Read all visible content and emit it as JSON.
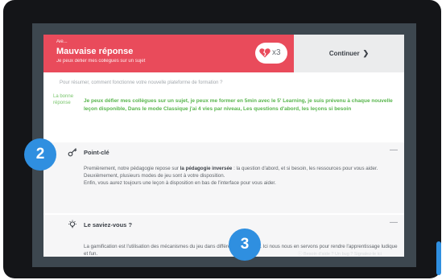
{
  "feedback": {
    "header_small": "Aie...",
    "title": "Mauvaise réponse",
    "subtitle": "Je peux défier mes collègues sur un sujet",
    "lives_count": "x3",
    "continue_label": "Continuer",
    "continue_icon": "chevron-right-icon"
  },
  "question": {
    "text": "Pour résumer, comment fonctionne votre nouvelle plateforme de formation ?",
    "answer_label": "La bonne réponse",
    "answer_text": "Je peux défier mes collègues sur un sujet, je peux me former en 5min avec le 5' Learning, je suis prévenu à chaque nouvelle leçon disponible, Dans le mode Classique j'ai 4 vies par niveau, Les questions d'abord, les leçons si besoin"
  },
  "sections": [
    {
      "icon": "key-icon",
      "title": "Point-clé",
      "collapse": "—",
      "body_prefix": "Premièrement, notre pédagogie repose sur ",
      "body_bold": "la pédagogie inversée",
      "body_suffix": " : la question d'abord, et si besoin, les ressources pour vous aider.",
      "line2": "Deuxièmement, plusieurs modes de jeu sont à votre disposition.",
      "line3": "Enfin, vous aurez toujours une leçon à disposition en bas de l'interface pour vous aider."
    },
    {
      "icon": "lightbulb-icon",
      "title": "Le saviez-vous ?",
      "collapse": "—",
      "body": "La gamification est l'utilisation des mécanismes du jeu dans différents domaines. Ici nous nous en servons pour rendre l'apprentissage ludique et fun."
    }
  ],
  "footer": {
    "help": "Besoin d'aide ? Un bug ? Signalez-le ici"
  },
  "steps": [
    "2",
    "3"
  ],
  "colors": {
    "error_red": "#e94b5b",
    "success_green": "#57b54c",
    "step_blue": "#2f8fe0"
  }
}
